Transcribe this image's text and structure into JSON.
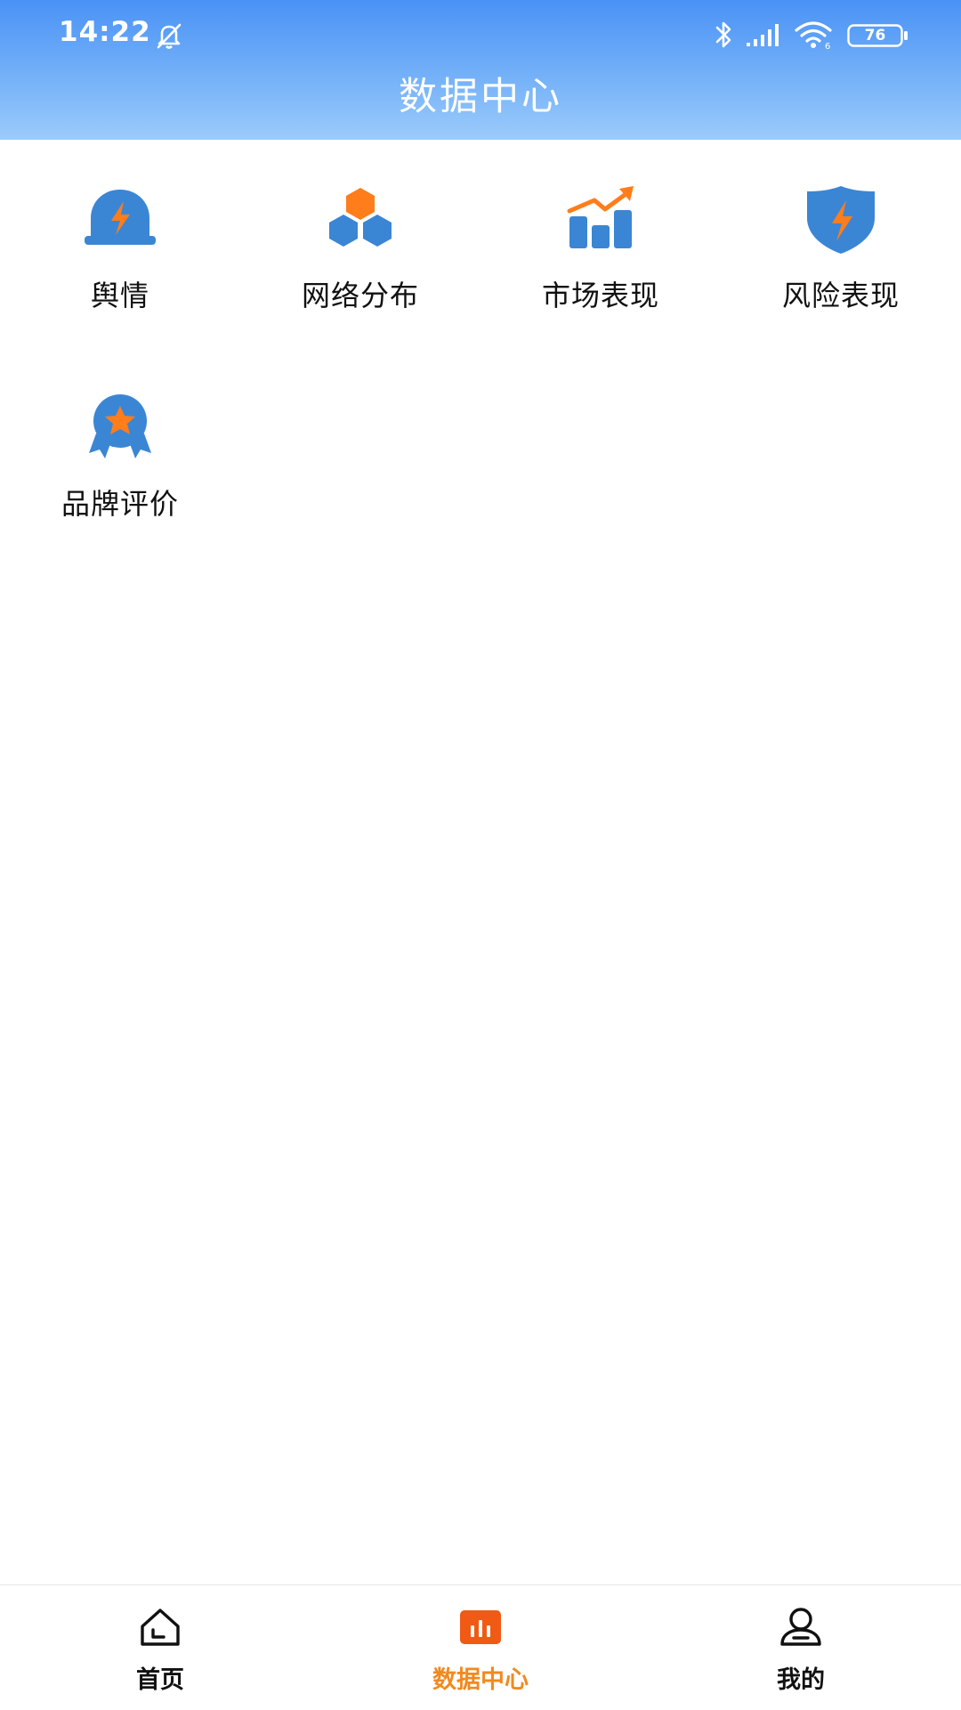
{
  "status_bar": {
    "time": "14:22",
    "battery_level": "76",
    "icons": [
      "mute-bell-icon",
      "bluetooth-icon",
      "signal-icon",
      "wifi-icon",
      "battery-icon"
    ]
  },
  "header": {
    "title": "数据中心"
  },
  "grid": {
    "items": [
      {
        "label": "舆情",
        "icon": "alarm-bolt-icon"
      },
      {
        "label": "网络分布",
        "icon": "hexagon-cluster-icon"
      },
      {
        "label": "市场表现",
        "icon": "bar-trend-icon"
      },
      {
        "label": "风险表现",
        "icon": "shield-bolt-icon"
      },
      {
        "label": "品牌评价",
        "icon": "award-badge-icon"
      }
    ]
  },
  "bottom_nav": {
    "items": [
      {
        "label": "首页",
        "icon": "home-icon",
        "active": false
      },
      {
        "label": "数据中心",
        "icon": "bar-chart-icon",
        "active": true
      },
      {
        "label": "我的",
        "icon": "user-icon",
        "active": false
      }
    ]
  },
  "colors": {
    "header_top": "#4a92f6",
    "header_bottom": "#9ccbfb",
    "icon_blue": "#3b86d4",
    "icon_orange": "#ff7d1a",
    "active_nav": "#f08a1f",
    "active_nav_icon": "#f05a14"
  }
}
